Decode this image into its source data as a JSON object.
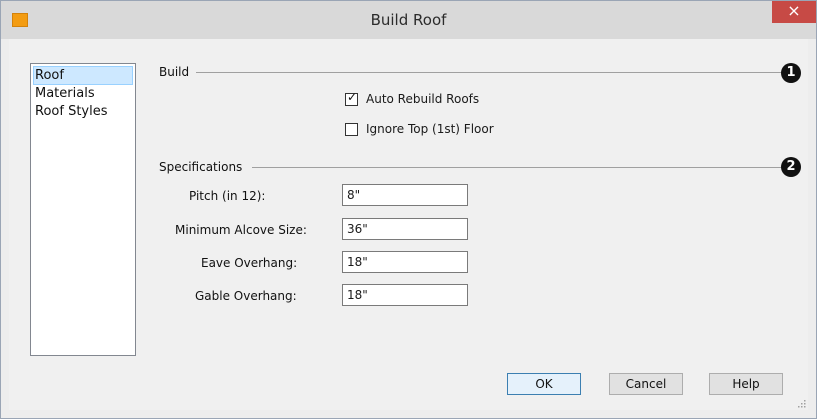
{
  "window": {
    "title": "Build Roof",
    "close_glyph": "×",
    "app_icon": "app-icon"
  },
  "sidebar": {
    "items": [
      {
        "label": "Roof",
        "selected": true
      },
      {
        "label": "Materials",
        "selected": false
      },
      {
        "label": "Roof Styles",
        "selected": false
      }
    ]
  },
  "build": {
    "heading": "Build",
    "marker": "1",
    "auto_rebuild": {
      "label": "Auto Rebuild Roofs",
      "checked": true
    },
    "ignore_top": {
      "label": "Ignore Top (1st) Floor",
      "checked": false
    }
  },
  "specifications": {
    "heading": "Specifications",
    "marker": "2",
    "fields": [
      {
        "label": "Pitch (in 12):",
        "value": "8\""
      },
      {
        "label": "Minimum Alcove Size:",
        "value": "36\""
      },
      {
        "label": "Eave Overhang:",
        "value": "18\""
      },
      {
        "label": "Gable Overhang:",
        "value": "18\""
      }
    ]
  },
  "buttons": {
    "ok": "OK",
    "cancel": "Cancel",
    "help": "Help"
  },
  "colors": {
    "title_bar": "#d9d9d9",
    "close_button": "#c74a45",
    "selection": "#cde8ff",
    "app_icon": "#f39c12"
  }
}
